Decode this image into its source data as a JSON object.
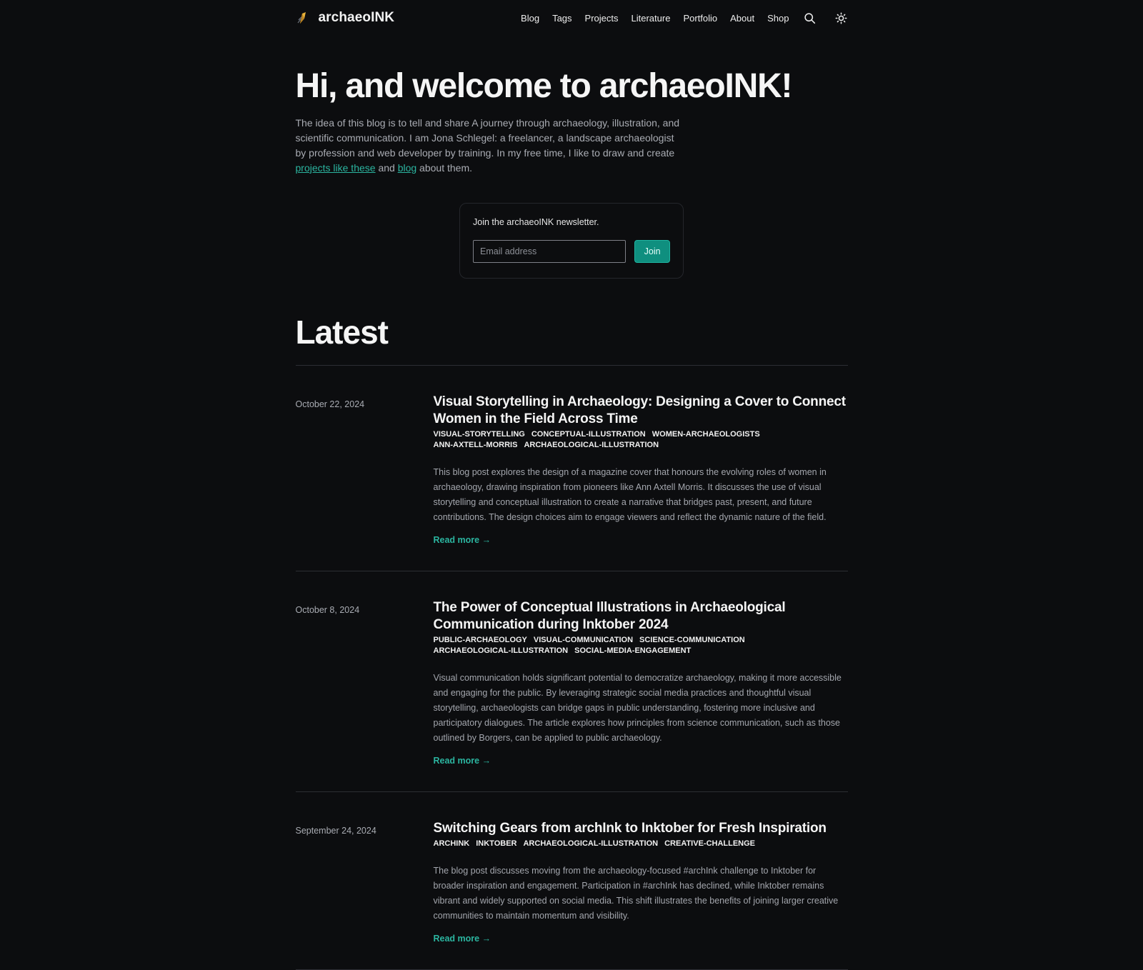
{
  "header": {
    "site_name": "archaeoINK",
    "nav": [
      {
        "label": "Blog"
      },
      {
        "label": "Tags"
      },
      {
        "label": "Projects"
      },
      {
        "label": "Literature"
      },
      {
        "label": "Portfolio"
      },
      {
        "label": "About"
      },
      {
        "label": "Shop"
      }
    ],
    "icons": {
      "search": "search-icon",
      "theme": "sun-icon",
      "logo": "quill-logo"
    }
  },
  "hero": {
    "title": "Hi, and welcome to archaeoINK!",
    "text_before": "The idea of this blog is to tell and share A journey through archaeology, illustration, and scientific communication. I am Jona Schlegel: a freelancer, a landscape archaeologist by profession and web developer by training. In my free time, I like to draw and create ",
    "link1": "projects like these",
    "text_mid": " and ",
    "link2": "blog",
    "text_after": " about them."
  },
  "newsletter": {
    "label": "Join the archaeoINK newsletter.",
    "email_placeholder": "Email address",
    "email_value": "",
    "button": "Join"
  },
  "latest": {
    "title": "Latest",
    "read_more": "Read more →",
    "posts": [
      {
        "date": "October 22, 2024",
        "title": "Visual Storytelling in Archaeology: Designing a Cover to Connect Women in the Field Across Time",
        "tags": [
          "visual-storytelling",
          "conceptual-illustration",
          "women-archaeologists",
          "ann-axtell-morris",
          "archaeological-illustration"
        ],
        "summary": "This blog post explores the design of a magazine cover that honours the evolving roles of women in archaeology, drawing inspiration from pioneers like Ann Axtell Morris. It discusses the use of visual storytelling and conceptual illustration to create a narrative that bridges past, present, and future contributions. The design choices aim to engage viewers and reflect the dynamic nature of the field."
      },
      {
        "date": "October 8, 2024",
        "title": "The Power of Conceptual Illustrations in Archaeological Communication during Inktober 2024",
        "tags": [
          "public-archaeology",
          "visual-communication",
          "science-communication",
          "archaeological-illustration",
          "social-media-engagement"
        ],
        "summary": "Visual communication holds significant potential to democratize archaeology, making it more accessible and engaging for the public. By leveraging strategic social media practices and thoughtful visual storytelling, archaeologists can bridge gaps in public understanding, fostering more inclusive and participatory dialogues. The article explores how principles from science communication, such as those outlined by Borgers, can be applied to public archaeology."
      },
      {
        "date": "September 24, 2024",
        "title": "Switching Gears from archInk to Inktober for Fresh Inspiration",
        "tags": [
          "archink",
          "inktober",
          "archaeological-illustration",
          "creative-challenge"
        ],
        "summary": "The blog post discusses moving from the archaeology-focused #archInk challenge to Inktober for broader inspiration and engagement. Participation in #archInk has declined, while Inktober remains vibrant and widely supported on social media. This shift illustrates the benefits of joining larger creative communities to maintain momentum and visibility."
      }
    ]
  },
  "colors": {
    "background": "#0c0d0f",
    "accent": "#2bb5a0",
    "button": "#0f8f7f"
  }
}
